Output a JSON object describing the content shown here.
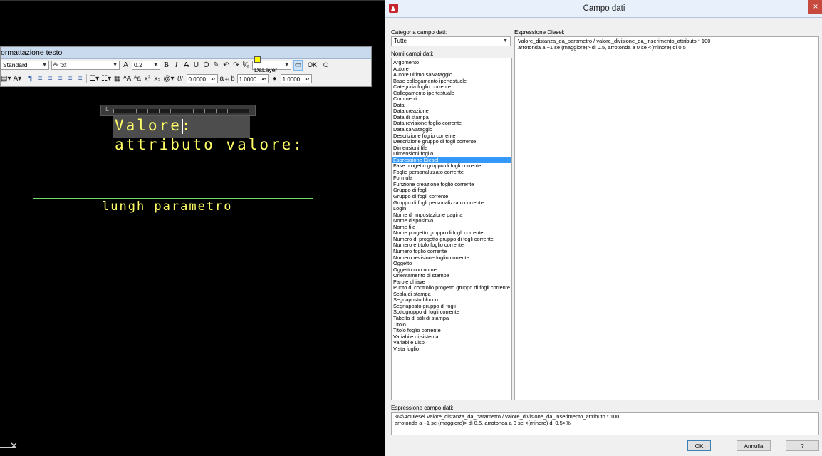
{
  "toolbar": {
    "title": "ormattazione testo",
    "style": "Standard",
    "font": "txt",
    "height": "0.2",
    "bold": "B",
    "italic": "I",
    "strike": "A",
    "underline": "U",
    "overline": "Ō",
    "color": "DaLayer",
    "ok": "OK",
    "oblique": "0.0000",
    "tracking": "1.0000",
    "width_factor": "1.0000"
  },
  "canvas": {
    "line1": "Valore:",
    "line2": "attributo valore:",
    "line3": "lungh parametro"
  },
  "dialog": {
    "title": "Campo dati",
    "close_icon": "×",
    "category_label": "Categoria campo dati:",
    "category_value": "Tutte",
    "names_label": "Nomi campi dati:",
    "expr_label": "Espressione Diesel:",
    "expr_line1": "Valore_distanza_da_parametro / valore_divisione_da_inserimento_attributo * 100",
    "expr_line2": "arrotonda  a +1 se (maggiore)> di 0.5, arrotonda a 0 se <(minore) di 0.5",
    "field_expr_label": "Espressione campo dati:",
    "field_expr_line1": "%<\\AcDiesel Valore_distanza_da_parametro / valore_divisione_da_inserimento_attributo * 100",
    "field_expr_line2": "arrotonda  a +1 se (maggiore)> di 0.5, arrotonda a 0 se <(minore) di 0.5>%",
    "ok": "OK",
    "cancel": "Annulla",
    "help": "?",
    "selected_item": "Espressione Diesel",
    "items": [
      "Argomento",
      "Autore",
      "Autore ultimo salvataggio",
      "Base collegamento ipertestuale",
      "Categoria foglio corrente",
      "Collegamento ipertestuale",
      "Commenti",
      "Data",
      "Data creazione",
      "Data di stampa",
      "Data revisione foglio corrente",
      "Data salvataggio",
      "Descrizione foglio corrente",
      "Descrizione gruppo di fogli corrente",
      "Dimensioni file",
      "Dimensioni foglio",
      "Espressione Diesel",
      "Fase progetto gruppo di fogli corrente",
      "Foglio personalizzato corrente",
      "Formula",
      "Funzione creazione foglio corrente",
      "Gruppo di fogli",
      "Gruppo di fogli corrente",
      "Gruppo di fogli personalizzato corrente",
      "Login",
      "Nome di impostazione pagina",
      "Nome dispositivo",
      "Nome file",
      "Nome progetto gruppo di fogli corrente",
      "Numero di progetto gruppo di fogli corrente",
      "Numero e titolo foglio corrente",
      "Numero foglio corrente",
      "Numero revisione foglio corrente",
      "Oggetto",
      "Oggetto con nome",
      "Orientamento di stampa",
      "Parole chiave",
      "Punto di controllo progetto gruppo di fogli corrente",
      "Scala di stampa",
      "Segnaposto blocco",
      "Segnaposto gruppo di fogli",
      "Sottogruppo di fogli corrente",
      "Tabella di stili di stampa",
      "Titolo",
      "Titolo foglio corrente",
      "Variabile di sistema",
      "Variabile Lisp",
      "Vista foglio"
    ]
  }
}
